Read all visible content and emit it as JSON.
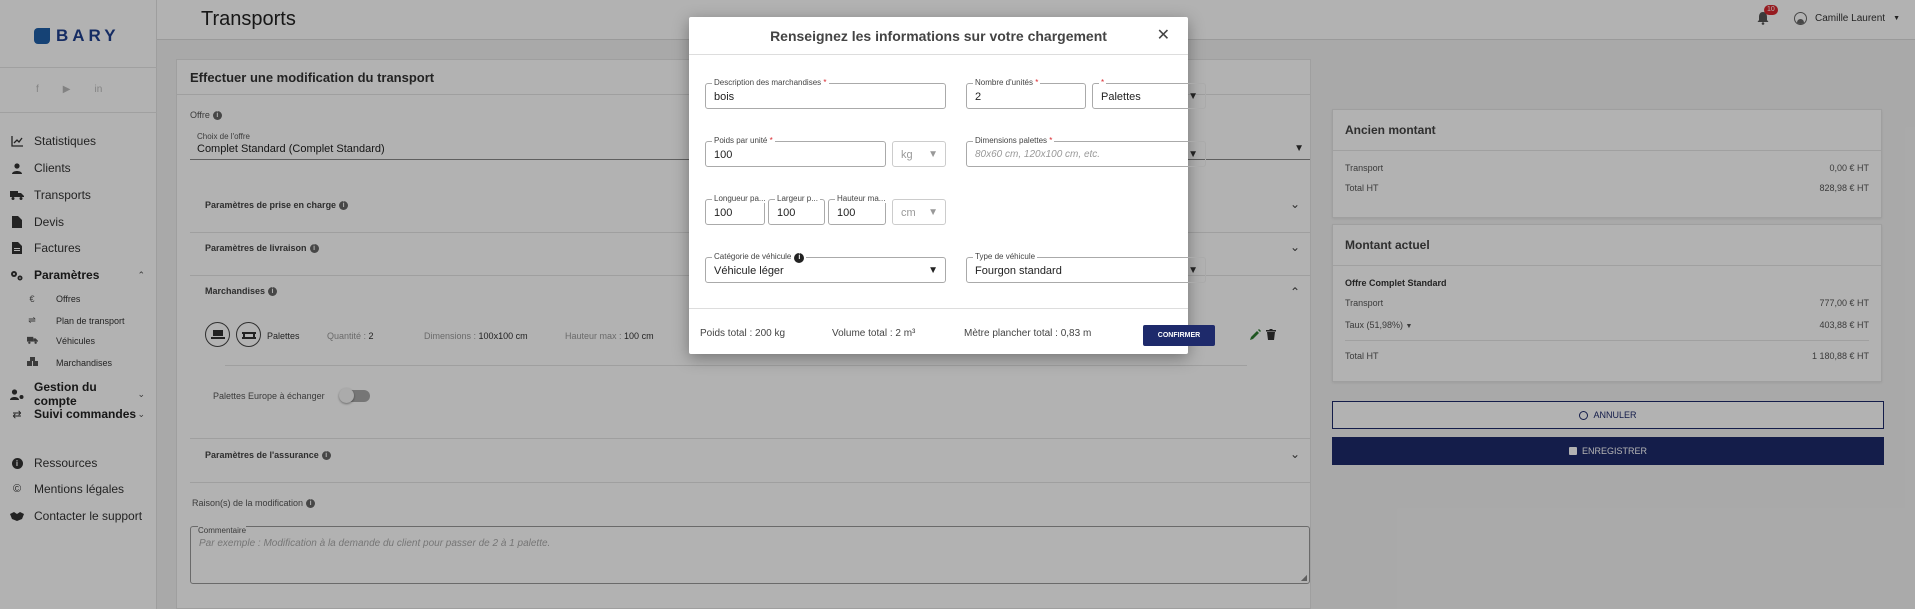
{
  "brand": {
    "name": "BARY",
    "color": "#1f3f8f"
  },
  "colors": {
    "primary": "#1e2a6b",
    "required": "#d9282f"
  },
  "sidebar": {
    "social": [
      "f",
      "▶",
      "in"
    ],
    "items": [
      {
        "label": "Statistiques",
        "icon": "chart-icon"
      },
      {
        "label": "Clients",
        "icon": "user-icon"
      },
      {
        "label": "Transports",
        "icon": "truck-icon"
      },
      {
        "label": "Devis",
        "icon": "document-icon"
      },
      {
        "label": "Factures",
        "icon": "invoice-icon"
      },
      {
        "label": "Paramètres",
        "icon": "settings-icon"
      }
    ],
    "sub_items": [
      {
        "label": "Offres",
        "icon": "euro-icon"
      },
      {
        "label": "Plan de transport",
        "icon": "route-icon"
      },
      {
        "label": "Véhicules",
        "icon": "truck-icon"
      },
      {
        "label": "Marchandises",
        "icon": "boxes-icon"
      }
    ],
    "account": {
      "label": "Gestion du compte"
    },
    "orders": {
      "label": "Suivi commandes"
    },
    "bottom": [
      {
        "label": "Ressources"
      },
      {
        "label": "Mentions légales"
      },
      {
        "label": "Contacter le support"
      }
    ]
  },
  "header": {
    "title": "Transports",
    "notif_count": "10",
    "user_name": "Camille Laurent"
  },
  "main": {
    "title": "Effectuer une modification du transport",
    "offer_label": "Offre",
    "offer_field_label": "Choix de l'offre",
    "offer_value": "Complet Standard (Complet Standard)",
    "pickup_label": "Paramètres de prise en charge",
    "delivery_label": "Paramètres de livraison",
    "goods_label": "Marchandises",
    "goods_row": {
      "type": "Palettes",
      "qty_label": "Quantité :",
      "qty": "2",
      "dim_label": "Dimensions :",
      "dim": "100x100 cm",
      "hmax_label": "Hauteur max :",
      "hmax": "100 cm"
    },
    "pallets_exchange_label": "Palettes Europe à échanger",
    "pallets_exchange_on": false,
    "insurance_label": "Paramètres de l'assurance",
    "reason_label": "Raison(s) de la modification",
    "comment_label": "Commentaire",
    "comment_placeholder": "Par exemple : Modification à la demande du client pour passer de 2 à 1 palette."
  },
  "old_amount": {
    "title": "Ancien montant",
    "rows": [
      {
        "label": "Transport",
        "value": "0,00 € HT"
      },
      {
        "label": "Total HT",
        "value": "828,98 € HT"
      }
    ]
  },
  "current_amount": {
    "title": "Montant actuel",
    "offer": "Offre Complet Standard",
    "transport_label": "Transport",
    "transport_value": "777,00 € HT",
    "rate_label": "Taux (51,98%)",
    "rate_value": "403,88 € HT",
    "total_label": "Total HT",
    "total_value": "1 180,88 € HT"
  },
  "actions": {
    "cancel": "ANNULER",
    "save": "ENREGISTRER"
  },
  "modal": {
    "title": "Renseignez les informations sur votre chargement",
    "description": {
      "label": "Description des marchandises",
      "value": "bois"
    },
    "units": {
      "label": "Nombre d'unités",
      "value": "2"
    },
    "unit_type": {
      "label": "",
      "value": "Palettes"
    },
    "weight": {
      "label": "Poids par unité",
      "value": "100"
    },
    "weight_unit": "kg",
    "pallet_dims": {
      "label": "Dimensions palettes",
      "placeholder": "80x60 cm, 120x100 cm, etc."
    },
    "length": {
      "label": "Longueur pa...",
      "value": "100"
    },
    "width": {
      "label": "Largeur p...",
      "value": "100"
    },
    "height": {
      "label": "Hauteur ma...",
      "value": "100"
    },
    "dim_unit": "cm",
    "vehicle_category": {
      "label": "Catégorie de véhicule",
      "value": "Véhicule léger"
    },
    "vehicle_type": {
      "label": "Type de véhicule",
      "value": "Fourgon standard"
    },
    "footer": {
      "total_weight": "Poids total : 200 kg",
      "total_volume": "Volume total : 2 m³",
      "floor_meters": "Mètre plancher total : 0,83 m",
      "confirm": "CONFIRMER"
    }
  }
}
